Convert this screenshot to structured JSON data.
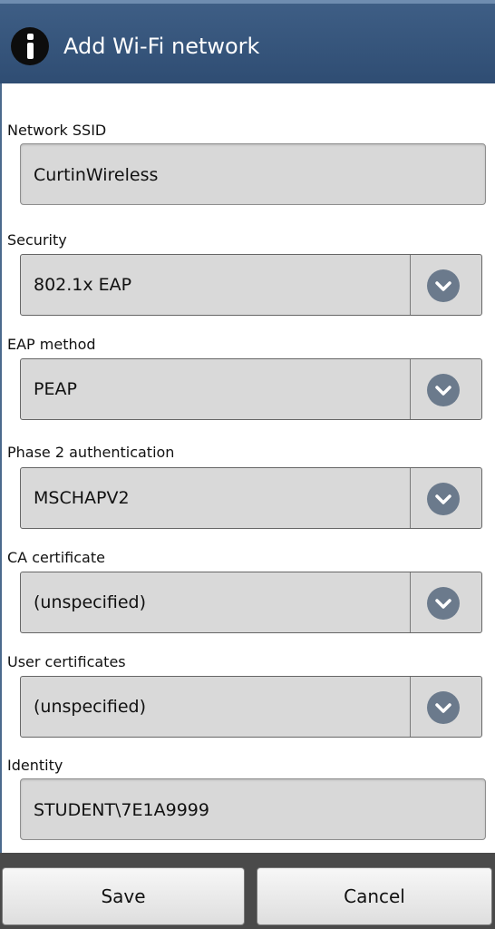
{
  "header": {
    "title": "Add Wi-Fi network",
    "icon": "info-icon"
  },
  "fields": {
    "ssid": {
      "label": "Network SSID",
      "value": "CurtinWireless"
    },
    "security": {
      "label": "Security",
      "value": "802.1x EAP"
    },
    "eap_method": {
      "label": "EAP method",
      "value": "PEAP"
    },
    "phase2": {
      "label": "Phase 2 authentication",
      "value": "MSCHAPV2"
    },
    "ca_cert": {
      "label": "CA certificate",
      "value": "(unspecified)"
    },
    "user_cert": {
      "label": "User certificates",
      "value": "(unspecified)"
    },
    "identity": {
      "label": "Identity",
      "value": "STUDENT\\7E1A9999"
    }
  },
  "buttons": {
    "save": "Save",
    "cancel": "Cancel"
  },
  "colors": {
    "header_bg": "#2f4d73",
    "dropdown_icon": "#6b7a8c",
    "bottom_bar": "#4a4a4a"
  }
}
